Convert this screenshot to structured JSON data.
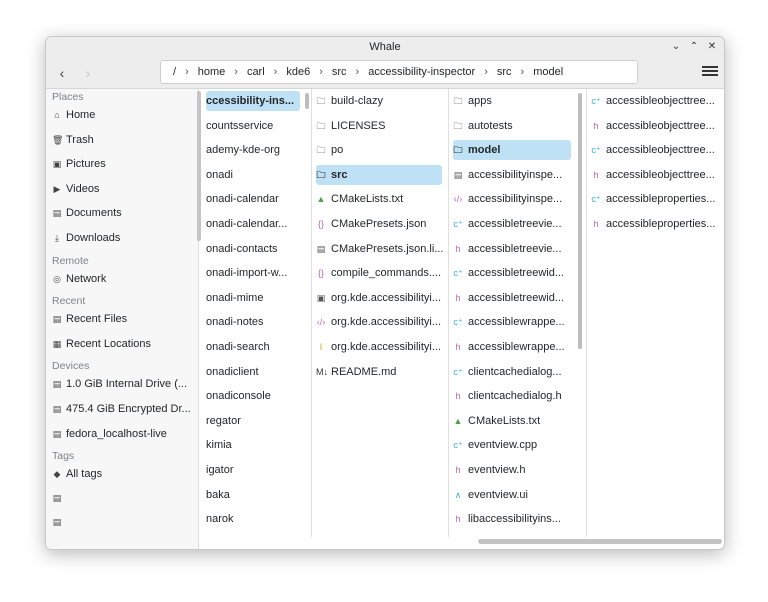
{
  "window": {
    "title": "Whale"
  },
  "toolbar": {
    "back_icon": "back-arrow-icon",
    "forward_icon": "forward-arrow-icon",
    "breadcrumb": [
      "/",
      "home",
      "carl",
      "kde6",
      "src",
      "accessibility-inspector",
      "src",
      "model"
    ],
    "menu_icon": "hamburger-menu-icon"
  },
  "sidebar": {
    "places_label": "Places",
    "places": [
      "Home",
      "Trash",
      "Pictures",
      "Videos",
      "Documents",
      "Downloads"
    ],
    "remote_label": "Remote",
    "remote": [
      "Network"
    ],
    "recent_label": "Recent",
    "recent": [
      "Recent Files",
      "Recent Locations"
    ],
    "devices_label": "Devices",
    "devices": [
      "1.0 GiB Internal Drive (...",
      "475.4 GiB Encrypted Dr...",
      "fedora_localhost-live"
    ],
    "tags_label": "Tags",
    "tags": [
      "All tags"
    ]
  },
  "columns": {
    "col1": [
      "ccessibility-ins...",
      "countsservice",
      "ademy-kde-org",
      "onadi",
      "onadi-calendar",
      "onadi-calendar...",
      "onadi-contacts",
      "onadi-import-w...",
      "onadi-mime",
      "onadi-notes",
      "onadi-search",
      "onadiclient",
      "onadiconsole",
      "regator",
      "kimia",
      "igator",
      "baka",
      "narok"
    ],
    "col2": [
      "build-clazy",
      "LICENSES",
      "po",
      "src",
      "CMakeLists.txt",
      "CMakePresets.json",
      "CMakePresets.json.li...",
      "compile_commands....",
      "org.kde.accessibilityi...",
      "org.kde.accessibilityi...",
      "org.kde.accessibilityi...",
      "README.md"
    ],
    "col3": [
      "apps",
      "autotests",
      "model",
      "accessibilityinspe...",
      "accessibilityinspe...",
      "accessibletreevie...",
      "accessibletreevie...",
      "accessibletreewid...",
      "accessibletreewid...",
      "accessiblewrappe...",
      "accessiblewrappe...",
      "clientcachedialog...",
      "clientcachedialog.h",
      "CMakeLists.txt",
      "eventview.cpp",
      "eventview.h",
      "eventview.ui",
      "libaccessibilityins..."
    ],
    "col4": [
      "accessibleobjecttree...",
      "accessibleobjecttree...",
      "accessibleobjecttree...",
      "accessibleobjecttree...",
      "accessibleproperties...",
      "accessibleproperties..."
    ]
  },
  "colors": {
    "selection": "#bfe1f5",
    "accent": "#3daee9",
    "header_icon_pink": "#c764b4",
    "cmake_green": "#4ea24e"
  }
}
